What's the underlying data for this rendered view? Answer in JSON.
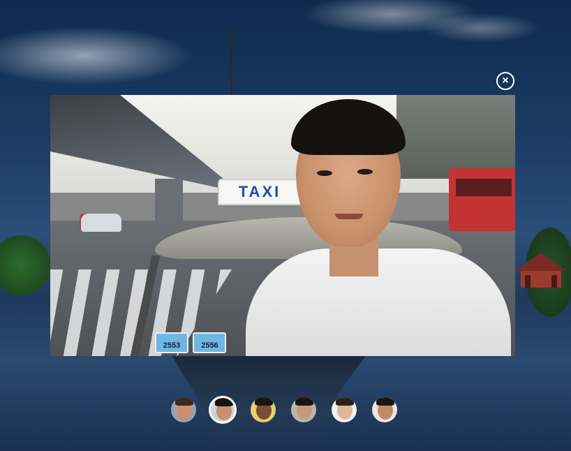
{
  "viewer": {
    "close_label": "×",
    "close_icon": "close-icon"
  },
  "photo": {
    "taxi_sign": "TAXI",
    "plates": [
      "2553",
      "2556"
    ]
  },
  "thumbnails": [
    {
      "name": "person-1",
      "skin": "#c9906c",
      "hair": "#3a2a22",
      "bg": "#9aa3ad",
      "active": false
    },
    {
      "name": "person-2",
      "skin": "#c9906c",
      "hair": "#151210",
      "bg": "#cbd2d8",
      "active": true
    },
    {
      "name": "person-3",
      "skin": "#7a4e34",
      "hair": "#1b1410",
      "bg": "#e6d070",
      "active": false
    },
    {
      "name": "person-4",
      "skin": "#c79a7a",
      "hair": "#1b1410",
      "bg": "#b8b5ad",
      "active": false
    },
    {
      "name": "person-5",
      "skin": "#e0b89a",
      "hair": "#2a211b",
      "bg": "#f1f1f1",
      "active": false
    },
    {
      "name": "person-6",
      "skin": "#c08a66",
      "hair": "#1a1512",
      "bg": "#ece6dc",
      "active": false
    }
  ],
  "colors": {
    "close_button": "#ffffff",
    "active_thumb_border": "#ffffff"
  }
}
